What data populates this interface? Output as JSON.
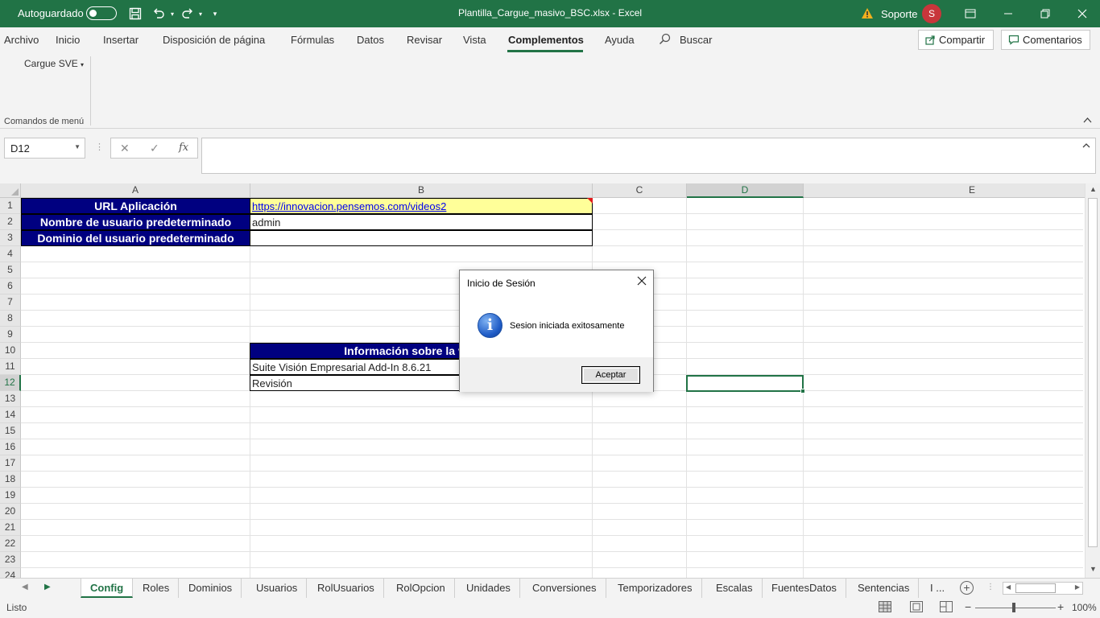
{
  "titlebar": {
    "autosave_label": "Autoguardado",
    "doc_title": "Plantilla_Cargue_masivo_BSC.xlsx  -  Excel",
    "user_name": "Soporte",
    "user_initial": "S"
  },
  "menu": {
    "items": [
      "Archivo",
      "Inicio",
      "Insertar",
      "Disposición de página",
      "Fórmulas",
      "Datos",
      "Revisar",
      "Vista",
      "Complementos",
      "Ayuda"
    ],
    "search_label": "Buscar",
    "share_label": "Compartir",
    "comments_label": "Comentarios"
  },
  "ribbon": {
    "cargue_label": "Cargue SVE",
    "group_label": "Comandos de menú"
  },
  "formula_bar": {
    "name_box": "D12",
    "cancel_glyph": "✕",
    "enter_glyph": "✓",
    "fx_label": "fx",
    "value": ""
  },
  "grid": {
    "columns": [
      "A",
      "B",
      "C",
      "D",
      "E"
    ],
    "rows": [
      "1",
      "2",
      "3",
      "4",
      "5",
      "6",
      "7",
      "8",
      "9",
      "10",
      "11",
      "12",
      "13",
      "14",
      "15",
      "16",
      "17",
      "18",
      "19",
      "20",
      "21",
      "22",
      "23",
      "24"
    ],
    "cells": {
      "A1": "URL Aplicación",
      "A2": "Nombre de usuario predeterminado",
      "A3": "Dominio del usuario predeterminado",
      "B1": "https://innovacion.pensemos.com/videos2",
      "B2": "admin",
      "B3": "",
      "B10": "Información sobre la versión",
      "B11": "Suite Visión Empresarial Add-In 8.6.21",
      "B12": "Revisión"
    }
  },
  "dialog": {
    "title": "Inicio de Sesión",
    "message": "Sesion iniciada exitosamente",
    "ok_label": "Aceptar",
    "icon_glyph": "i"
  },
  "sheets": {
    "tabs": [
      "Config",
      "Roles",
      "Dominios",
      "Usuarios",
      "RolUsuarios",
      "RolOpcion",
      "Unidades",
      "Conversiones",
      "Temporizadores",
      "Escalas",
      "FuentesDatos",
      "Sentencias"
    ],
    "more_label": "I ...",
    "active": "Config"
  },
  "status": {
    "text": "Listo",
    "zoom": "100%"
  },
  "colors": {
    "excel_green": "#217346",
    "navy_header": "#000080",
    "highlight_yellow": "#ffff99"
  }
}
